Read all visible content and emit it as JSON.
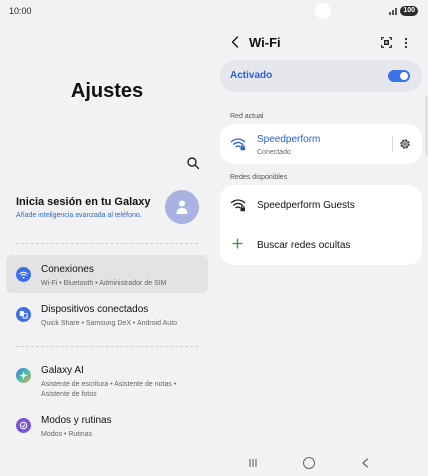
{
  "status_bar": {
    "time": "10:00",
    "battery": "100"
  },
  "left_panel": {
    "title": "Ajustes",
    "account": {
      "title": "Inicia sesión en tu Galaxy",
      "subtitle": "Añade inteligencia avanzada al teléfono."
    },
    "items": [
      {
        "title": "Conexiones",
        "subtitle": "Wi-Fi • Bluetooth • Administrador de SIM",
        "color": "#3c70e6"
      },
      {
        "title": "Dispositivos conectados",
        "subtitle": "Quick Share • Samsung DeX • Android Auto",
        "color": "#3c70e6"
      },
      {
        "title": "Galaxy AI",
        "subtitle": "Asistente de escritura • Asistente de notas • Asistente de fotos",
        "color": "#3a6fd8"
      },
      {
        "title": "Modos y rutinas",
        "subtitle": "Modos • Rutinas",
        "color": "#7a55d6"
      }
    ]
  },
  "right_panel": {
    "title": "Wi-Fi",
    "toggle": {
      "label": "Activado",
      "on": true
    },
    "current_network_label": "Red actual",
    "current_network": {
      "name": "Speedperform",
      "status": "Conectado"
    },
    "available_label": "Redes disponibles",
    "available_networks": [
      {
        "name": "Speedperform Guests"
      }
    ],
    "hidden_networks_label": "Buscar redes ocultas"
  },
  "colors": {
    "accent": "#2a5fd0",
    "add_green": "#2e9e4a"
  }
}
